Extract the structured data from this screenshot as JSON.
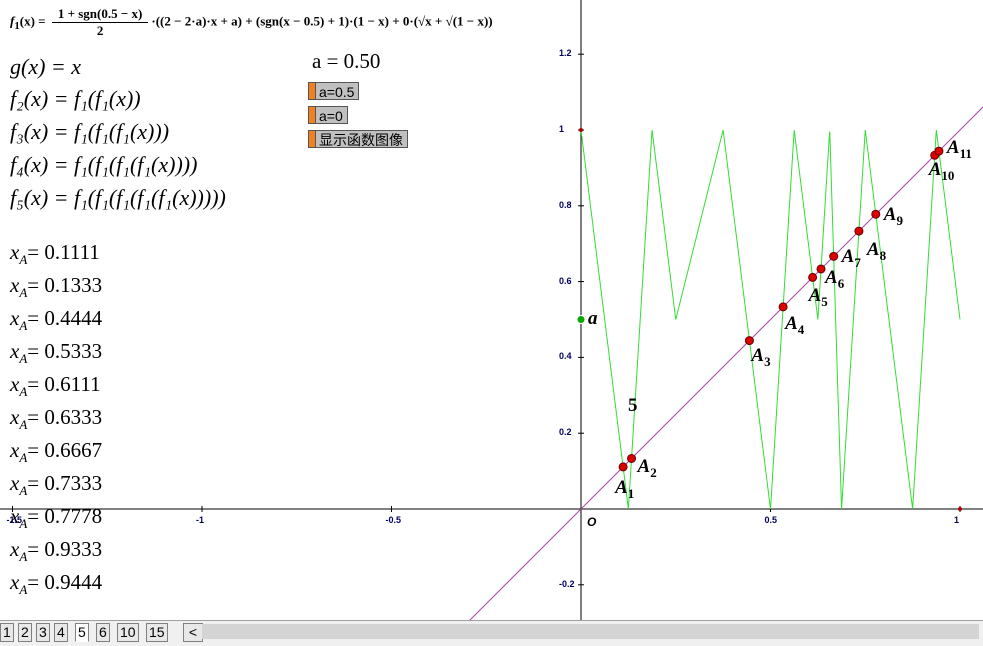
{
  "formula_f1": {
    "lhs": "f",
    "lhs_sub": "1",
    "lhs_arg": "(x) =",
    "numerator": "1 + sgn(0.5 − x)",
    "denominator": "2",
    "rest": "·((2 − 2·a)·x + a) + (sgn(x − 0.5) + 1)·(1 − x) + 0·(√x + √(1 − x))"
  },
  "definitions": [
    "g(x) = x",
    "f₂(x) = f₁(f₁(x))",
    "f₃(x) = f₁(f₁(f₁(x)))",
    "f₄(x) = f₁(f₁(f₁(f₁(x))))",
    "f₅(x) = f₁(f₁(f₁(f₁(f₁(x)))))"
  ],
  "param_a": "a = 0.50",
  "buttons": {
    "a_half": "a=0.5",
    "a_zero": "a=0",
    "show_graph": "显示函数图像"
  },
  "xa_values": [
    {
      "sub": "1",
      "value": "= 0.1111"
    },
    {
      "sub": "2",
      "value": "= 0.1333"
    },
    {
      "sub": "3",
      "value": "= 0.4444"
    },
    {
      "sub": "4",
      "value": "= 0.5333"
    },
    {
      "sub": "5",
      "value": "= 0.6111"
    },
    {
      "sub": "6",
      "value": "= 0.6333"
    },
    {
      "sub": "7",
      "value": "= 0.6667"
    },
    {
      "sub": "8",
      "value": "= 0.7333"
    },
    {
      "sub": "9",
      "value": "= 0.7778"
    },
    {
      "sub": "10",
      "value": "= 0.9333"
    },
    {
      "sub": "11",
      "value": "= 0.9444"
    }
  ],
  "xa_symbol": "x",
  "xa_subsymbol": "A",
  "graph": {
    "x_ticks": [
      "-1.5",
      "-1",
      "-0.5",
      "O",
      "0.5",
      "1"
    ],
    "y_ticks": [
      "1.2",
      "1",
      "0.8",
      "0.6",
      "0.4",
      "0.2",
      "-0.2"
    ],
    "curve_color": "#33dd33",
    "line_color": "#aa44aa",
    "point_color": "#dd0000",
    "a_point_color": "#00aa00",
    "a_label": "a",
    "curve_label": "5",
    "points": [
      {
        "name": "A",
        "sub": "1",
        "x": 0.1111
      },
      {
        "name": "A",
        "sub": "2",
        "x": 0.1333
      },
      {
        "name": "A",
        "sub": "3",
        "x": 0.4444
      },
      {
        "name": "A",
        "sub": "4",
        "x": 0.5333
      },
      {
        "name": "A",
        "sub": "5",
        "x": 0.6111
      },
      {
        "name": "A",
        "sub": "6",
        "x": 0.6333
      },
      {
        "name": "A",
        "sub": "7",
        "x": 0.6667
      },
      {
        "name": "A",
        "sub": "8",
        "x": 0.7333
      },
      {
        "name": "A",
        "sub": "9",
        "x": 0.7778
      },
      {
        "name": "A",
        "sub": "10",
        "x": 0.9333
      },
      {
        "name": "A",
        "sub": "11",
        "x": 0.9444
      }
    ],
    "a_value": 0.5
  },
  "tabs": [
    "1",
    "2",
    "3",
    "4",
    "5",
    "6",
    "10",
    "15"
  ],
  "active_tab": "5",
  "tab_scroll": "<"
}
